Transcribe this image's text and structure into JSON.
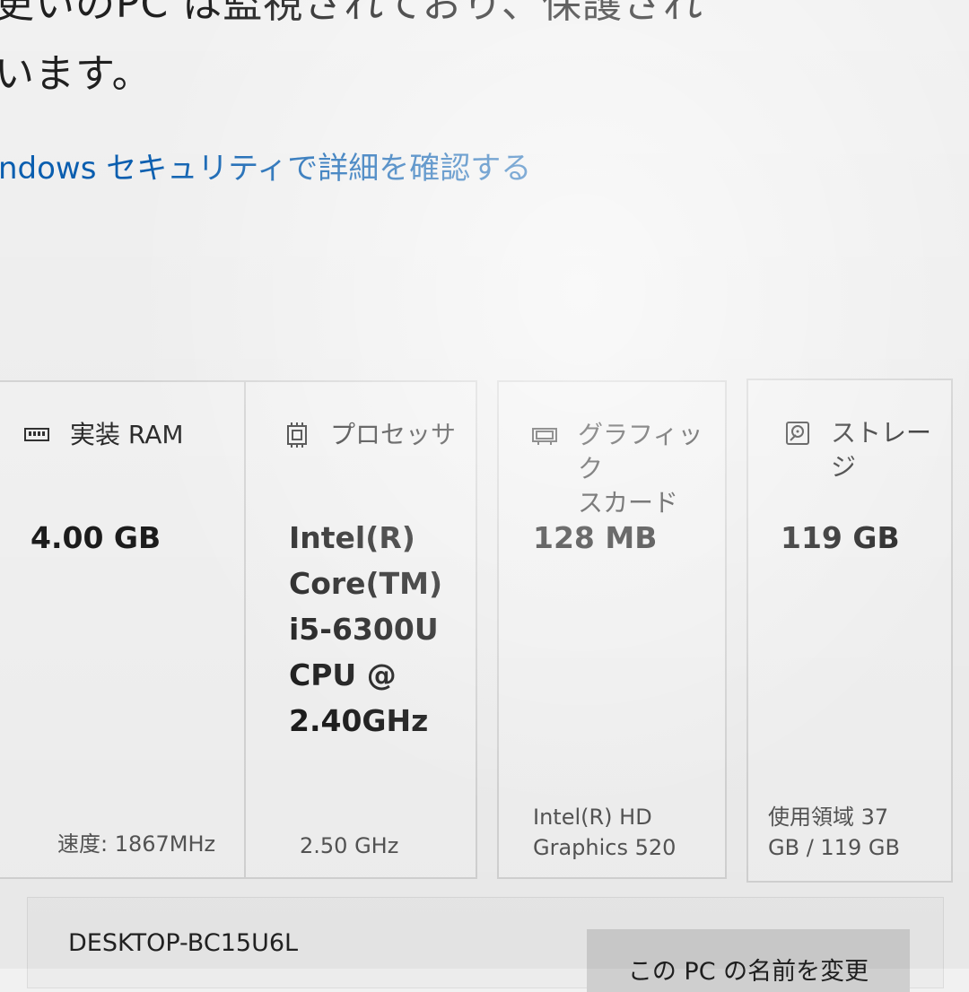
{
  "security": {
    "status_text": "このPC は監視されており、保護されています。",
    "visible_line_1": "更いのPC は監視されており、保護され",
    "visible_line_2": "います。",
    "link_label": "ndows セキュリティで詳細を確認する"
  },
  "specs": {
    "ram": {
      "title": "実装 RAM",
      "value": "4.00 GB",
      "detail": "速度: 1867MHz",
      "icon": "memory-icon"
    },
    "processor": {
      "title": "プロセッサ",
      "value": "Intel(R)\nCore(TM)\ni5-6300U\nCPU @\n2.40GHz",
      "detail": "2.50 GHz",
      "icon": "processor-icon"
    },
    "graphics": {
      "title": "グラフィック\nスカード",
      "value": "128 MB",
      "detail": "Intel(R) HD\nGraphics 520",
      "icon": "graphics-card-icon"
    },
    "storage": {
      "title": "ストレージ",
      "value": "119 GB",
      "detail": "使用領域 37\nGB / 119 GB",
      "icon": "storage-icon"
    }
  },
  "device": {
    "name": "DESKTOP-BC15U6L",
    "rename_button_label": "この PC の名前を変更"
  },
  "colors": {
    "link": "#0a5fb0",
    "card_border": "#d6d6d6",
    "button_bg": "#cfcfcf"
  }
}
